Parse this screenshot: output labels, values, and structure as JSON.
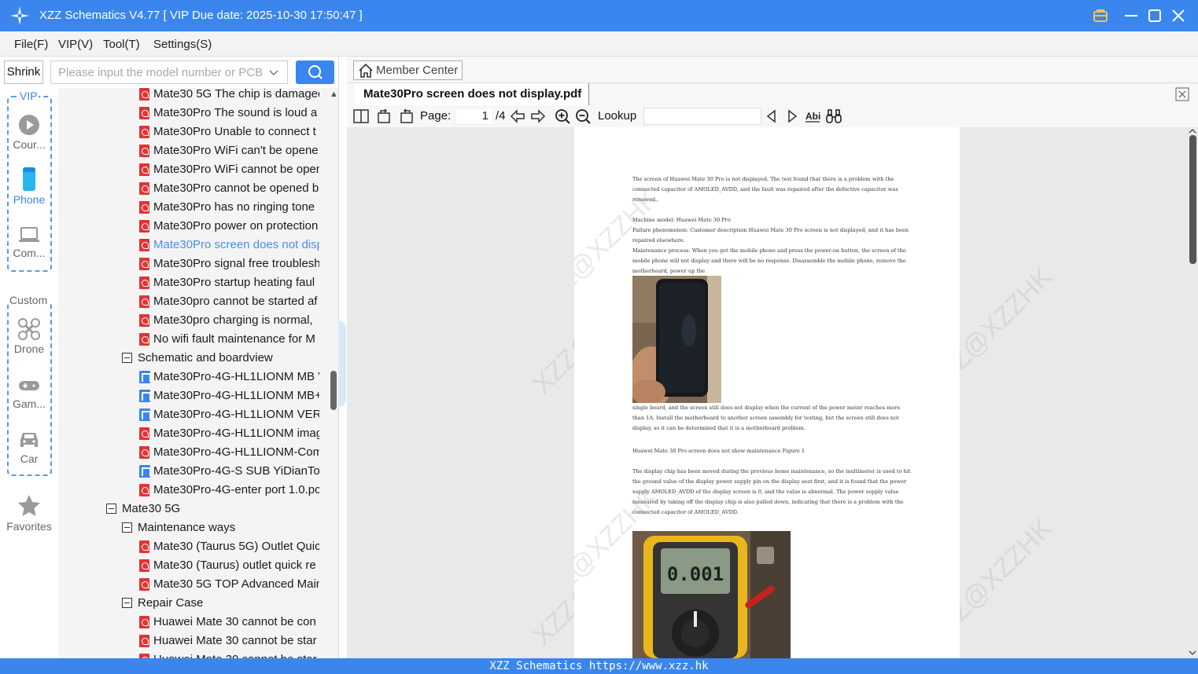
{
  "window": {
    "title": "XZZ Schematics V4.77 [ VIP Due date: 2025-10-30 17:50:47 ]"
  },
  "menu": [
    "File(F)",
    "VIP(V)",
    "Tool(T)",
    "Settings(S)"
  ],
  "toolbar": {
    "shrink_label": "Shrink",
    "search_placeholder": "Please input the model number or PCB"
  },
  "sidebar": {
    "vip_group": "VIP",
    "custom_group": "Custom",
    "items": [
      {
        "label": "Cour...",
        "icon": "play-icon"
      },
      {
        "label": "Phone",
        "icon": "phone-icon"
      },
      {
        "label": "Com...",
        "icon": "laptop-icon"
      },
      {
        "label": "Drone",
        "icon": "drone-icon"
      },
      {
        "label": "Gam...",
        "icon": "gamepad-icon"
      },
      {
        "label": "Car",
        "icon": "car-icon"
      },
      {
        "label": "Favorites",
        "icon": "star-icon"
      }
    ]
  },
  "tree": {
    "rows": [
      {
        "type": "pdf",
        "label": "Mate30 5G The chip is damaged"
      },
      {
        "type": "pdf",
        "label": "Mate30Pro The sound is loud a"
      },
      {
        "type": "pdf",
        "label": "Mate30Pro Unable to connect t"
      },
      {
        "type": "pdf",
        "label": "Mate30Pro WiFi can't be opene"
      },
      {
        "type": "pdf",
        "label": "Mate30Pro WiFi cannot be open"
      },
      {
        "type": "pdf",
        "label": "Mate30Pro cannot be opened b"
      },
      {
        "type": "pdf",
        "label": "Mate30Pro has no ringing tone"
      },
      {
        "type": "pdf",
        "label": "Mate30Pro power on protection"
      },
      {
        "type": "pdf",
        "label": "Mate30Pro screen does not disp",
        "selected": true
      },
      {
        "type": "pdf",
        "label": "Mate30Pro signal free troublesh"
      },
      {
        "type": "pdf",
        "label": "Mate30Pro startup heating faul"
      },
      {
        "type": "pdf",
        "label": "Mate30pro cannot be started af"
      },
      {
        "type": "pdf",
        "label": "Mate30pro charging is normal, "
      },
      {
        "type": "pdf",
        "label": "No wifi fault maintenance for M"
      },
      {
        "type": "folder",
        "label": "Schematic and boardview"
      },
      {
        "type": "sch",
        "label": "Mate30Pro-4G-HL1LIONM MB V"
      },
      {
        "type": "sch",
        "label": "Mate30Pro-4G-HL1LIONM MB+"
      },
      {
        "type": "sch",
        "label": "Mate30Pro-4G-HL1LIONM VER."
      },
      {
        "type": "pdf",
        "label": "Mate30Pro-4G-HL1LIONM imag"
      },
      {
        "type": "pdf",
        "label": "Mate30Pro-4G-HL1LIONM-Com"
      },
      {
        "type": "sch",
        "label": "Mate30Pro-4G-S SUB YiDianTon"
      },
      {
        "type": "pdf",
        "label": "Mate30Pro-4G-enter port 1.0.pc"
      },
      {
        "type": "folder0",
        "label": "Mate30 5G"
      },
      {
        "type": "folder",
        "label": "Maintenance ways"
      },
      {
        "type": "pdf",
        "label": "Mate30 (Taurus 5G) Outlet Quic"
      },
      {
        "type": "pdf",
        "label": "Mate30 (Taurus) outlet quick re"
      },
      {
        "type": "pdf",
        "label": "Mate30 5G TOP Advanced Main"
      },
      {
        "type": "folder",
        "label": "Repair Case"
      },
      {
        "type": "pdf",
        "label": "Huawei Mate 30 cannot be con"
      },
      {
        "type": "pdf",
        "label": "Huawei Mate 30 cannot be star"
      },
      {
        "type": "pdf",
        "label": "Huawei Mate 30 cannot be star"
      }
    ]
  },
  "viewer": {
    "member_center": "Member Center",
    "tab_title": "Mate30Pro screen does not display.pdf",
    "page_label": "Page:",
    "page_current": "1",
    "page_total": "/4",
    "lookup_label": "Lookup",
    "watermark": "XZZ@XZZHK",
    "doc": {
      "para1": "The screen of Huawei Mate 30 Pro is not displayed. The test found that there is a problem with the connected capacitor of AMOLED_AVDD, and the fault was repaired after the defective capacitor was removed.",
      "para2a": "Machine model: Huawei Mate 30 Pro",
      "para2b": "Failure phenomenon: Customer description Huawei Mate 30 Pro screen is not displayed, and it has been repaired elsewhere.",
      "para2c": "Maintenance process: When you get the mobile phone and press the power-on button, the screen of the mobile phone will not display and there will be no response. Disassemble the mobile phone, remove the motherboard, power up the",
      "para3": "single board, and the screen still does not display when the current of the power meter reaches more than 1A. Install the motherboard to another screen assembly for testing, but the screen still does not display, so it can be determined that it is a motherboard problem.",
      "caption": "Huawei Mate 30 Pro screen does not show maintenance Figure 1",
      "para4": "The display chip has been moved during the previous home maintenance, so the multimeter is used to hit the ground value of the display power supply pin on the display seat first, and it is found that the power supply AMOLED_AVDD of the display screen is 0, and the value is abnormal. The power supply value measured by taking off the display chip is also pulled down, indicating that there is a problem with the connected capacitor of AMOLED_AVDD.",
      "meter_reading": "0.001"
    }
  },
  "status": {
    "text": "XZZ Schematics https://www.xzz.hk"
  },
  "colors": {
    "accent": "#3a86ee",
    "selected": "#4a8fe8",
    "pdf": "#e03535"
  }
}
